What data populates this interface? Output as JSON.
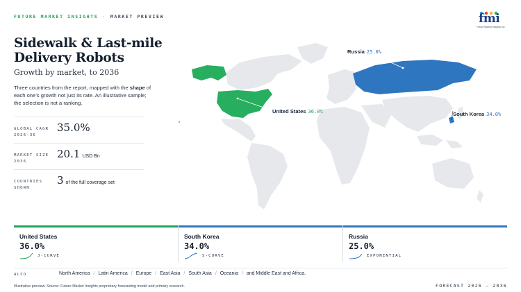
{
  "header": {
    "brand": "FUTURE MARKET INSIGHTS",
    "separator": "·",
    "section": "MARKET PREVIEW",
    "logo_text": "fmi",
    "logo_tagline": "Future Market Insights Inc."
  },
  "hero": {
    "title": "Sidewalk & Last-mile Delivery Robots",
    "subtitle": "Growth by market, to 2036",
    "intro_pre": "Three countries from the report, mapped with the ",
    "intro_bold": "shape",
    "intro_post": " of each one’s growth not just its rate. An illustrative sample; the selection is not a ranking."
  },
  "stats": [
    {
      "label_line1": "GLOBAL CAGR",
      "label_line2": "2026–36",
      "value": "35.0%",
      "unit": ""
    },
    {
      "label_line1": "MARKET SIZE",
      "label_line2": "2036",
      "value": "20.1",
      "unit": "USD Bn"
    },
    {
      "label_line1": "COUNTRIES",
      "label_line2": "SHOWN",
      "value": "3",
      "unit": "of the full coverage set"
    }
  ],
  "map": {
    "labels": [
      {
        "name": "Russia",
        "value": "25.0%"
      },
      {
        "name": "United States",
        "value": "36.0%"
      },
      {
        "name": "South Korea",
        "value": "34.0%"
      }
    ],
    "colors": {
      "land": "#e6e8eb",
      "green": "#27ae5f",
      "blue": "#2f76c0"
    }
  },
  "cards": [
    {
      "country": "United States",
      "value": "36.0%",
      "shape": "J-CURVE",
      "color": "#1ea359"
    },
    {
      "country": "South Korea",
      "value": "34.0%",
      "shape": "S-CURVE",
      "color": "#2f76c0"
    },
    {
      "country": "Russia",
      "value": "25.0%",
      "shape": "EXPONENTIAL",
      "color": "#2f76c0"
    }
  ],
  "also": {
    "label": "ALSO",
    "regions": [
      "North America",
      "Latin America",
      "Europe",
      "East Asia",
      "South Asia",
      "Oceania",
      "and Middle East and Africa."
    ]
  },
  "footer": {
    "note": "Illustrative preview. Source: Future Market Insights proprietary forecasting model and primary research.",
    "forecast": "FORECAST 2026 – 2036"
  }
}
